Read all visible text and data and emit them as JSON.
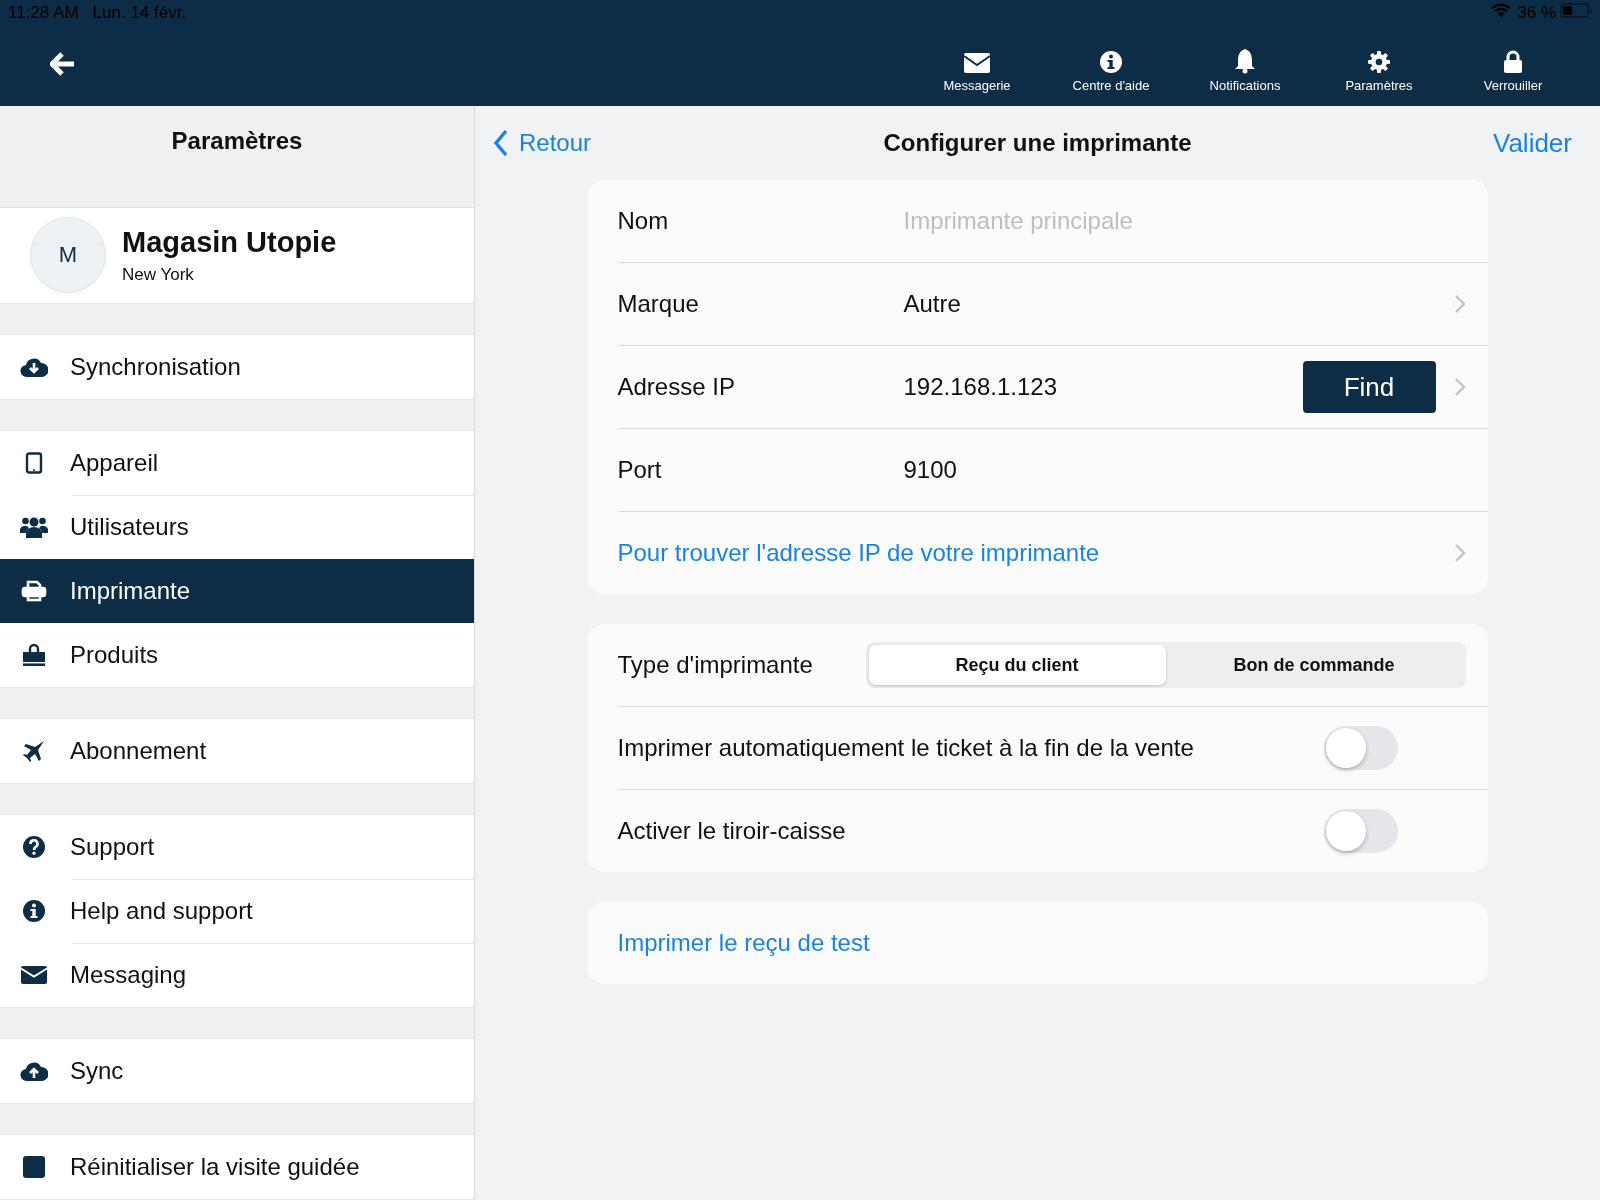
{
  "status_bar": {
    "time": "11:28 AM",
    "date": "Lun. 14 févr.",
    "battery": "36 %"
  },
  "toolbar": {
    "items": [
      {
        "label": "Messagerie"
      },
      {
        "label": "Centre d'aide"
      },
      {
        "label": "Notifications"
      },
      {
        "label": "Paramètres"
      },
      {
        "label": "Verrouiller"
      }
    ]
  },
  "sidebar": {
    "title": "Paramètres",
    "profile": {
      "initial": "M",
      "name": "Magasin Utopie",
      "city": "New York"
    },
    "groups": [
      [
        {
          "label": "Synchronisation",
          "selected": false
        }
      ],
      [
        {
          "label": "Appareil",
          "selected": false
        },
        {
          "label": "Utilisateurs",
          "selected": false
        },
        {
          "label": "Imprimante",
          "selected": true
        },
        {
          "label": "Produits",
          "selected": false
        }
      ],
      [
        {
          "label": "Abonnement",
          "selected": false
        }
      ],
      [
        {
          "label": "Support",
          "selected": false
        },
        {
          "label": "Help and support",
          "selected": false
        },
        {
          "label": "Messaging",
          "selected": false
        }
      ],
      [
        {
          "label": "Sync",
          "selected": false
        }
      ],
      [
        {
          "label": "Réinitialiser la visite guidée",
          "selected": false
        }
      ]
    ]
  },
  "detail": {
    "back": "Retour",
    "title": "Configurer une imprimante",
    "confirm": "Valider",
    "printer_card": [
      {
        "kind": "field",
        "label": "Nom",
        "placeholder": "Imprimante principale"
      },
      {
        "kind": "choice",
        "label": "Marque",
        "value": "Autre"
      },
      {
        "kind": "ip",
        "label": "Adresse IP",
        "value": "192.168.1.123",
        "button": "Find"
      },
      {
        "kind": "text",
        "label": "Port",
        "value": "9100"
      },
      {
        "kind": "link",
        "label": "Pour trouver l'adresse IP de votre imprimante"
      }
    ],
    "options_card": [
      {
        "kind": "segmented",
        "label": "Type d'imprimante",
        "options": [
          {
            "label": "Reçu du client",
            "selected": true
          },
          {
            "label": "Bon de commande",
            "selected": false
          }
        ]
      },
      {
        "kind": "toggle",
        "label": "Imprimer automatiquement le ticket à la fin de la vente",
        "on": false
      },
      {
        "kind": "toggle",
        "label": "Activer le tiroir-caisse",
        "on": false
      }
    ],
    "test_link": "Imprimer le reçu de test"
  }
}
